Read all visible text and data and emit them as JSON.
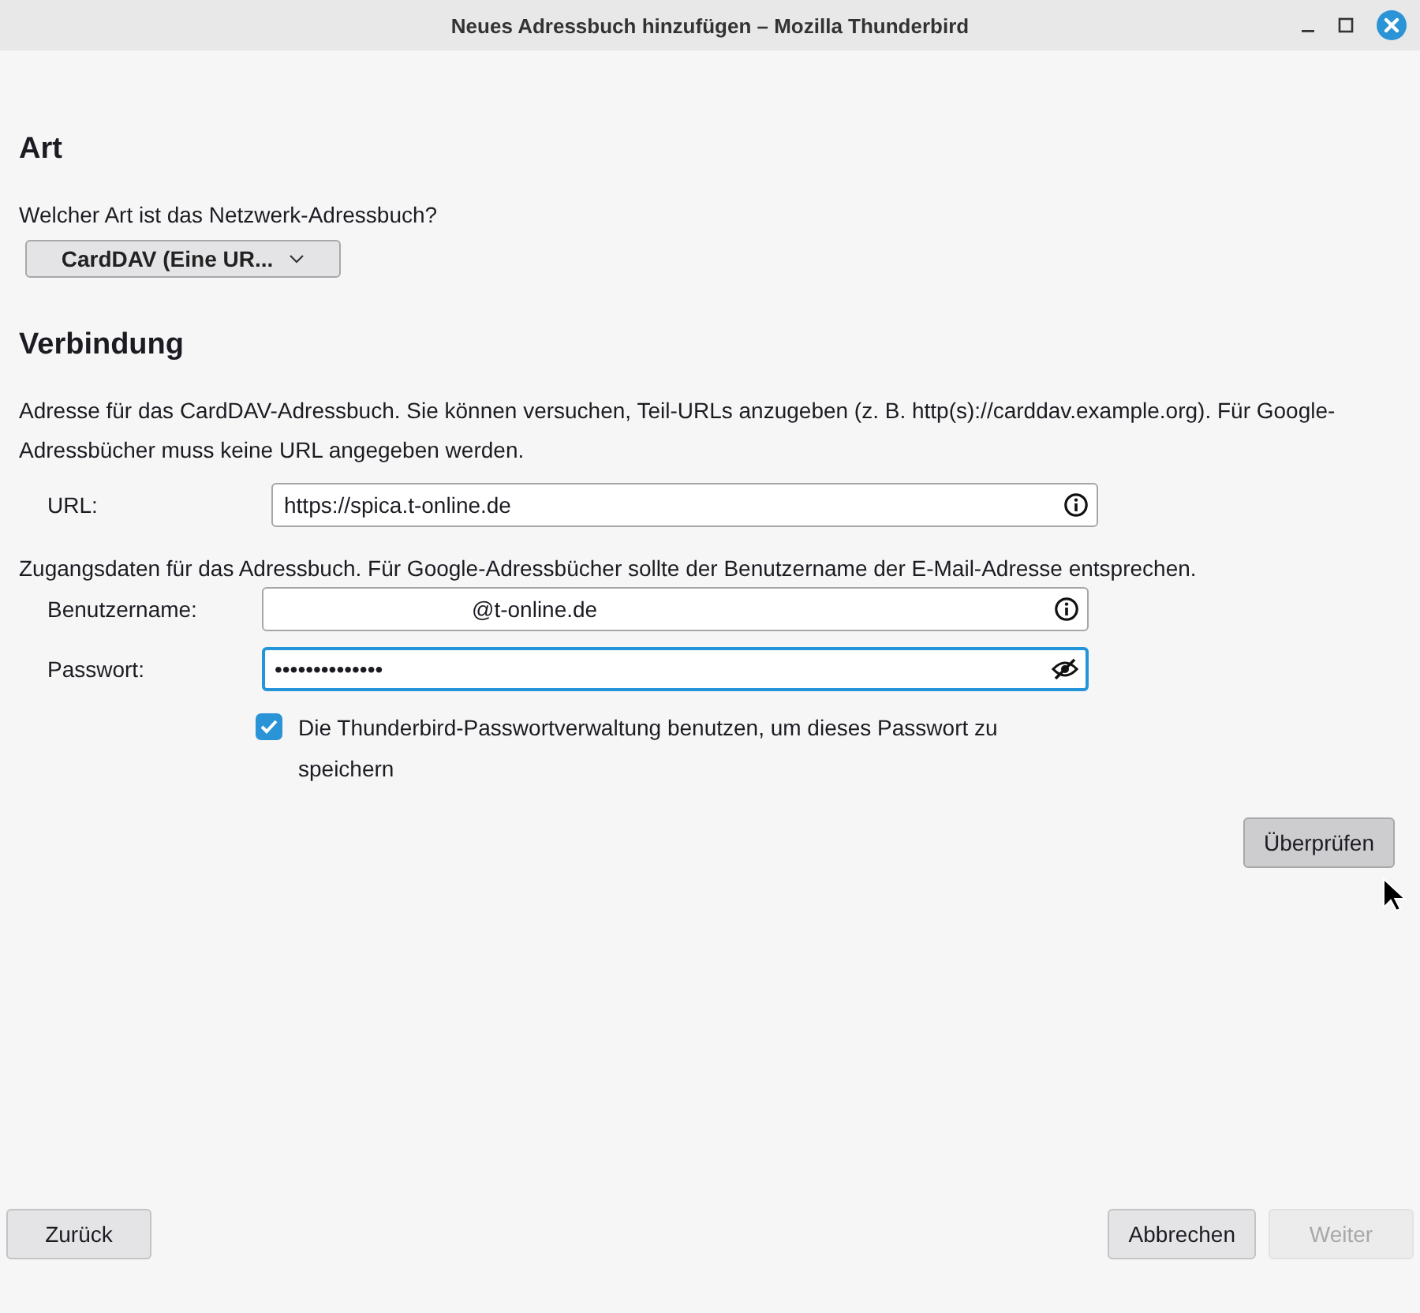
{
  "window": {
    "title": "Neues Adressbuch hinzufügen – Mozilla Thunderbird"
  },
  "type_section": {
    "heading": "Art",
    "question": "Welcher Art ist das Netzwerk-Adressbuch?",
    "dropdown": "CardDAV (Eine UR..."
  },
  "connection": {
    "heading": "Verbindung",
    "description": "Adresse für das CardDAV-Adressbuch. Sie können versuchen, Teil-URLs anzugeben (z. B. http(s)://carddav.example.org). Für Google-Adressbücher muss keine URL angegeben werden.",
    "url_field": {
      "label": "URL:",
      "value": "https://spica.t-online.de",
      "focused": false
    },
    "credentials_note": "Zugangsdaten für das Adressbuch. Für Google-Adressbücher sollte der Benutzername der E-Mail-Adresse entsprechen.",
    "fields": [
      {
        "label": "Benutzername:",
        "value": "@t-online.de",
        "kind": "info",
        "focused": false
      },
      {
        "label": "Passwort:",
        "value": "••••••••••••••",
        "kind": "password",
        "focused": true
      }
    ],
    "remember_password": {
      "label": "Die Thunderbird-Passwortverwaltung benutzen, um dieses Passwort zu speichern",
      "checked": true
    },
    "check_button": {
      "label": "Überprüfen",
      "hovered": true
    }
  },
  "footer": {
    "buttons": [
      {
        "label": "Zurück",
        "disabled": false
      },
      {
        "label": "Abbrechen",
        "disabled": false
      },
      {
        "label": "Weiter",
        "disabled": true
      }
    ]
  }
}
